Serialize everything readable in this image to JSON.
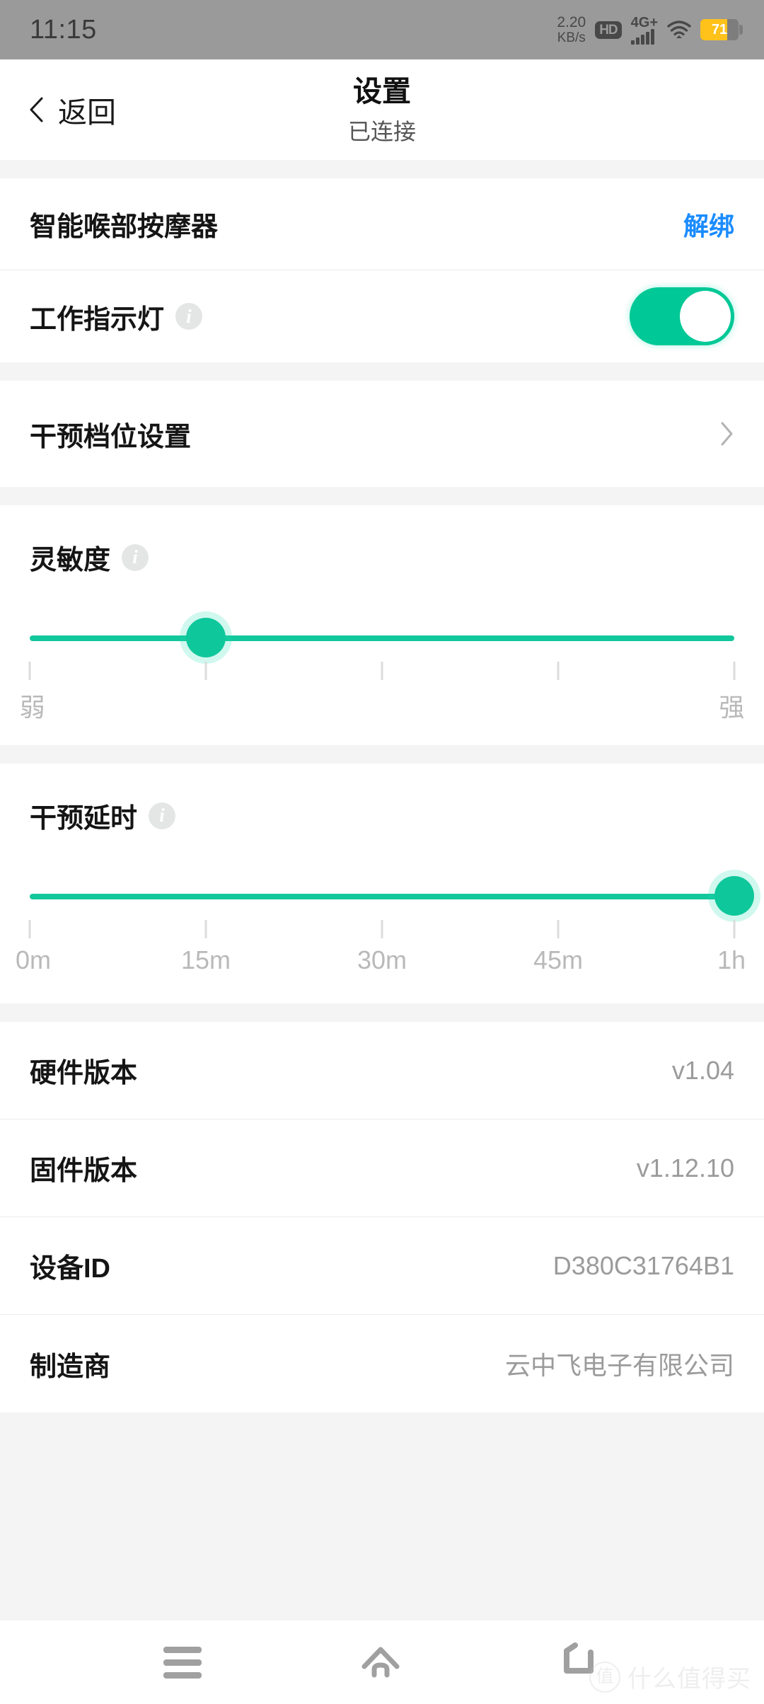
{
  "status_bar": {
    "clock": "11:15",
    "net_speed_value": "2.20",
    "net_speed_unit": "KB/s",
    "hd_badge": "HD",
    "network_type": "4G+",
    "battery_percent": "71",
    "battery_level": 71,
    "wifi_icon": "wifi-icon",
    "background_color": "#9a9a9a"
  },
  "header": {
    "back_label": "返回",
    "title": "设置",
    "subtitle": "已连接"
  },
  "device": {
    "name": "智能喉部按摩器",
    "unbind_label": "解绑",
    "unbind_color": "#1a8cff"
  },
  "indicator": {
    "label": "工作指示灯",
    "info_icon": "info-icon",
    "toggle_on": true,
    "toggle_color": "#00c896"
  },
  "level_settings": {
    "label": "干预档位设置",
    "chevron_icon": "chevron-right-icon"
  },
  "sensitivity": {
    "label": "灵敏度",
    "info_icon": "info-icon",
    "value_percent": 25,
    "ticks": [
      0,
      25,
      50,
      75,
      100
    ],
    "scale_labels": [
      {
        "text": "弱",
        "pos": 0
      },
      {
        "text": "强",
        "pos": 100
      }
    ],
    "accent_color": "#0ec79b"
  },
  "delay": {
    "label": "干预延时",
    "info_icon": "info-icon",
    "value_percent": 100,
    "ticks": [
      0,
      25,
      50,
      75,
      100
    ],
    "scale_labels": [
      {
        "text": "0m",
        "pos": 0
      },
      {
        "text": "15m",
        "pos": 25
      },
      {
        "text": "30m",
        "pos": 50
      },
      {
        "text": "45m",
        "pos": 75
      },
      {
        "text": "1h",
        "pos": 100
      }
    ],
    "accent_color": "#0ec79b"
  },
  "info_rows": [
    {
      "label": "硬件版本",
      "value": "v1.04"
    },
    {
      "label": "固件版本",
      "value": "v1.12.10"
    },
    {
      "label": "设备ID",
      "value": "D380C31764B1"
    },
    {
      "label": "制造商",
      "value": "云中飞电子有限公司"
    }
  ],
  "nav_bar": {
    "menu_icon": "menu-icon",
    "home_icon": "home-icon",
    "back_icon": "back-icon"
  },
  "watermark": {
    "logo_char": "值",
    "text": "什么值得买"
  }
}
